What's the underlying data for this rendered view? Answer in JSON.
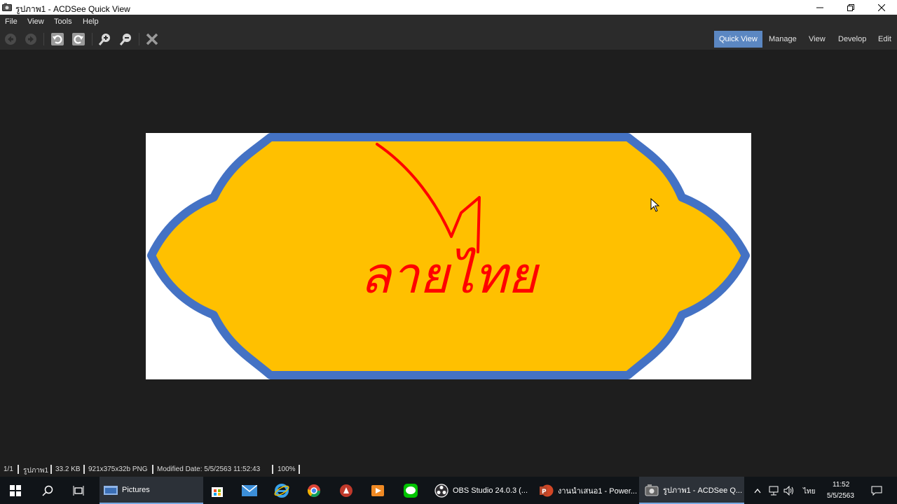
{
  "window": {
    "title": "รูปภาพ1 - ACDSee Quick View"
  },
  "menu": [
    "File",
    "View",
    "Tools",
    "Help"
  ],
  "modes": {
    "quick_view": "Quick View",
    "manage": "Manage",
    "view": "View",
    "develop": "Develop",
    "edit": "Edit",
    "active": "Quick View"
  },
  "image": {
    "text": "ลายไทย",
    "fill_color": "#ffc000",
    "border_color": "#4472c4",
    "text_color": "#ff0000"
  },
  "status": {
    "index": "1/1",
    "name": "รูปภาพ1",
    "size": "33.2 KB",
    "info": "921x375x32b PNG",
    "modified": "Modified Date: 5/5/2563 11:52:43",
    "zoom": "100%"
  },
  "taskbar": {
    "pictures": "Pictures",
    "obs": "OBS Studio 24.0.3 (...",
    "powerpoint": "งานนำเสนอ1 - Power...",
    "acdsee": "รูปภาพ1 - ACDSee Q...",
    "lang": "ไทย",
    "time": "11:52",
    "date": "5/5/2563"
  }
}
